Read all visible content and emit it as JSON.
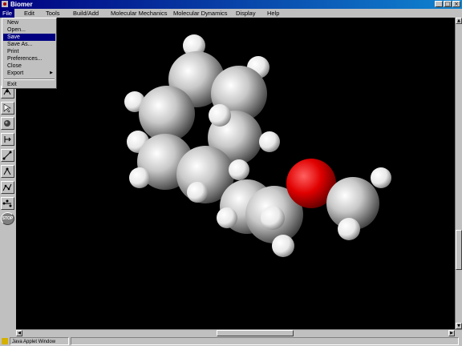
{
  "window": {
    "title": "Biomer"
  },
  "menubar": {
    "items": [
      "File",
      "Edit",
      "Tools",
      "Build/Add",
      "Molecular Mechanics",
      "Molecular Dynamics",
      "Display",
      "Help"
    ]
  },
  "file_menu": {
    "items": [
      "New",
      "Open...",
      "Save",
      "Save As...",
      "Print",
      "Preferences...",
      "Close",
      "Export",
      "Exit"
    ],
    "selected": "Save"
  },
  "toolbar": {
    "stop_label": "STOP"
  },
  "statusbar": {
    "text": "Java Applet Window"
  },
  "colors": {
    "title_start": "#000080",
    "title_end": "#1084d0",
    "menu_highlight": "#000080",
    "canvas_bg": "#000000",
    "carbon": "#c8c8c8",
    "hydrogen": "#f0f0f0",
    "oxygen": "#e00000"
  }
}
